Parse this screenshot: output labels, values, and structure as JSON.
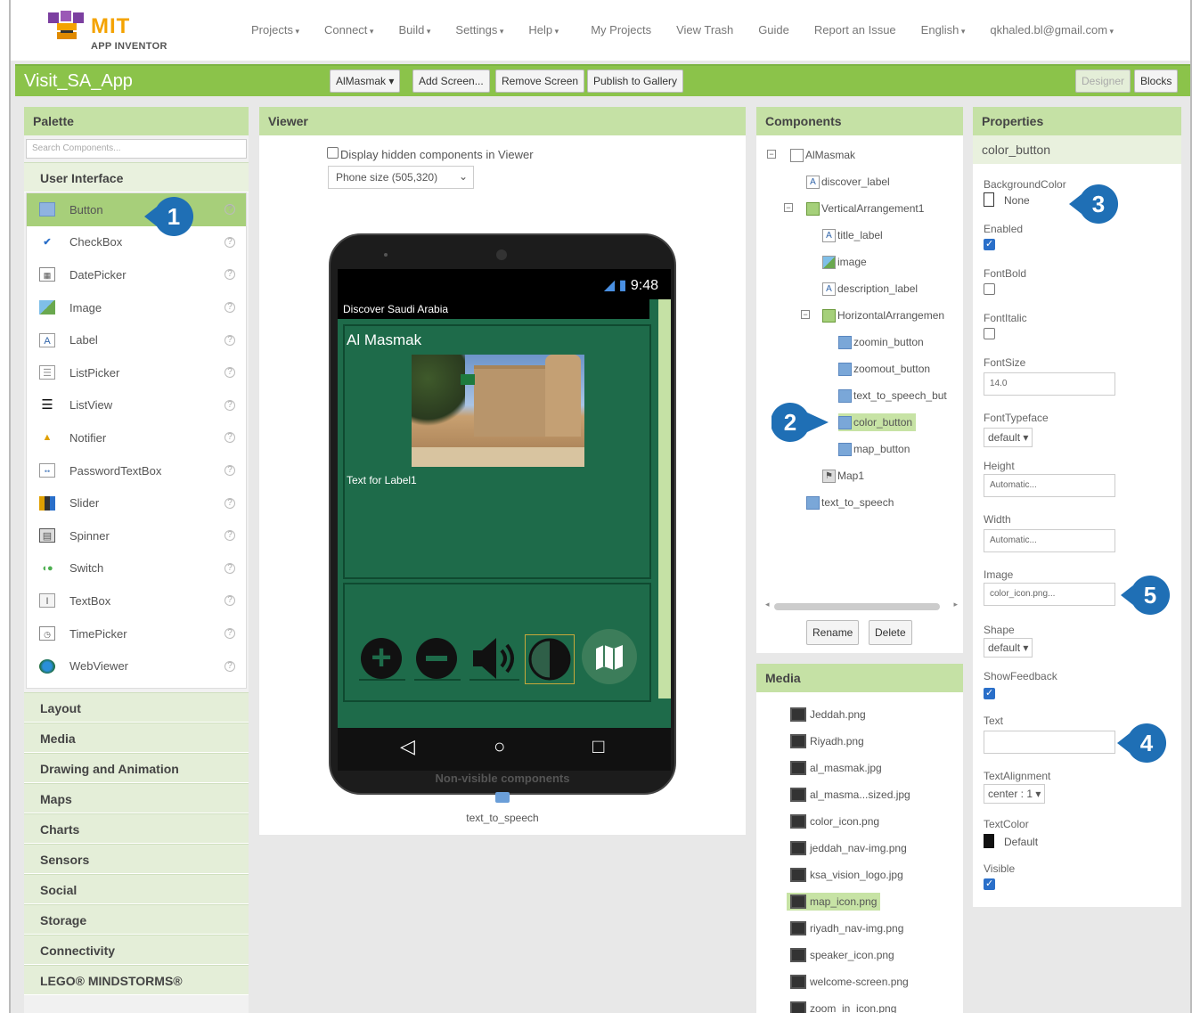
{
  "nav": {
    "logo_mit": "MIT",
    "logo_sub": "APP INVENTOR",
    "items": [
      "Projects",
      "Connect",
      "Build",
      "Settings",
      "Help",
      "My Projects",
      "View Trash",
      "Guide",
      "Report an Issue",
      "English",
      "qkhaled.bl@gmail.com"
    ]
  },
  "toolbar": {
    "project_title": "Visit_SA_App",
    "screen_select": "AlMasmak ▾",
    "add_screen": "Add Screen...",
    "remove_screen": "Remove Screen",
    "publish": "Publish to Gallery",
    "designer": "Designer",
    "blocks": "Blocks"
  },
  "palette": {
    "title": "Palette",
    "search_placeholder": "Search Components...",
    "open_category": "User Interface",
    "items": [
      "Button",
      "CheckBox",
      "DatePicker",
      "Image",
      "Label",
      "ListPicker",
      "ListView",
      "Notifier",
      "PasswordTextBox",
      "Slider",
      "Spinner",
      "Switch",
      "TextBox",
      "TimePicker",
      "WebViewer"
    ],
    "categories": [
      "Layout",
      "Media",
      "Drawing and Animation",
      "Maps",
      "Charts",
      "Sensors",
      "Social",
      "Storage",
      "Connectivity",
      "LEGO® MINDSTORMS®"
    ]
  },
  "viewer": {
    "title": "Viewer",
    "hidden_label": "Display hidden components in Viewer",
    "phone_size": "Phone size (505,320)",
    "status_time": "9:48",
    "app_title": "Discover Saudi Arabia",
    "heading": "Al Masmak",
    "label_text": "Text for Label1",
    "nonvisible_title": "Non-visible components",
    "nonvisible_item": "text_to_speech"
  },
  "components": {
    "title": "Components",
    "tree": [
      "AlMasmak",
      "discover_label",
      "VerticalArrangement1",
      "title_label",
      "image",
      "description_label",
      "HorizontalArrangemen",
      "zoomin_button",
      "zoomout_button",
      "text_to_speech_but",
      "color_button",
      "map_button",
      "Map1",
      "text_to_speech"
    ],
    "rename": "Rename",
    "delete": "Delete"
  },
  "media": {
    "title": "Media",
    "items": [
      "Jeddah.png",
      "Riyadh.png",
      "al_masmak.jpg",
      "al_masma...sized.jpg",
      "color_icon.png",
      "jeddah_nav-img.png",
      "ksa_vision_logo.jpg",
      "map_icon.png",
      "riyadh_nav-img.png",
      "speaker_icon.png",
      "welcome-screen.png",
      "zoom_in_icon.png"
    ]
  },
  "properties": {
    "title": "Properties",
    "component": "color_button",
    "background_color_label": "BackgroundColor",
    "background_color_value": "None",
    "enabled_label": "Enabled",
    "fontbold_label": "FontBold",
    "fontitalic_label": "FontItalic",
    "fontsize_label": "FontSize",
    "fontsize_value": "14.0",
    "fonttypeface_label": "FontTypeface",
    "fonttypeface_value": "default ▾",
    "height_label": "Height",
    "height_value": "Automatic...",
    "width_label": "Width",
    "width_value": "Automatic...",
    "image_label": "Image",
    "image_value": "color_icon.png...",
    "shape_label": "Shape",
    "shape_value": "default ▾",
    "showfeedback_label": "ShowFeedback",
    "text_label": "Text",
    "text_value": "",
    "textalignment_label": "TextAlignment",
    "textalignment_value": "center : 1 ▾",
    "textcolor_label": "TextColor",
    "textcolor_value": "Default",
    "visible_label": "Visible"
  },
  "badges": [
    "1",
    "2",
    "3",
    "4",
    "5"
  ],
  "colors": {
    "accent": "#8bc34a",
    "badge": "#1f6fb5",
    "app_green": "#1e6b4a"
  }
}
